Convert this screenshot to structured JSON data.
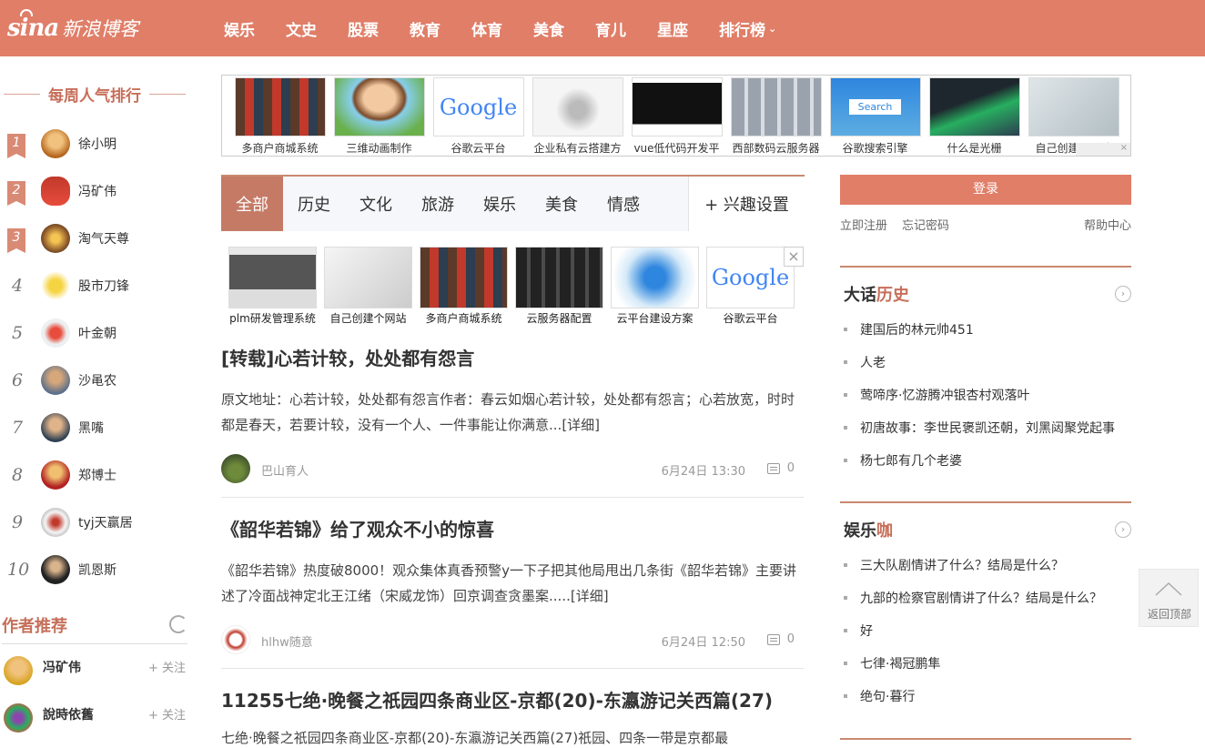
{
  "brand": {
    "logo": "sina",
    "name": "新浪博客",
    "nav_color": "#e07e68",
    "accent": "#c66f5a"
  },
  "nav": {
    "items": [
      "娱乐",
      "文史",
      "股票",
      "教育",
      "体育",
      "美食",
      "育儿",
      "星座"
    ],
    "ranking": "排行榜"
  },
  "weekly_rank": {
    "title": "每周人气排行",
    "entries": [
      {
        "rank": "1",
        "name": "徐小明"
      },
      {
        "rank": "2",
        "name": "冯矿伟"
      },
      {
        "rank": "3",
        "name": "淘气天尊"
      },
      {
        "rank": "4",
        "name": "股市刀锋"
      },
      {
        "rank": "5",
        "name": "叶金朝"
      },
      {
        "rank": "6",
        "name": "沙黾农"
      },
      {
        "rank": "7",
        "name": "黑嘴"
      },
      {
        "rank": "8",
        "name": "郑博士"
      },
      {
        "rank": "9",
        "name": "tyj天赢居"
      },
      {
        "rank": "10",
        "name": "凯恩斯"
      }
    ]
  },
  "author_rec": {
    "title": "作者推荐",
    "follow": "+ 关注",
    "authors": [
      {
        "name": "冯矿伟"
      },
      {
        "name": "說時依舊"
      }
    ]
  },
  "top_ads": [
    "多商户商城系统",
    "三维动画制作",
    "谷歌云平台",
    "企业私有云搭建方",
    "vue低代码开发平",
    "西部数码云服务器",
    "谷歌搜索引擎",
    "什么是光栅",
    "自己创建个网站"
  ],
  "ad_search_label": "Search",
  "ad_google_label": "Google",
  "tabs": {
    "items": [
      "全部",
      "历史",
      "文化",
      "旅游",
      "娱乐",
      "美食",
      "情感"
    ],
    "active": "全部",
    "setting": "+ 兴趣设置"
  },
  "inner_ads": [
    "plm研发管理系统",
    "自己创建个网站",
    "多商户商城系统",
    "云服务器配置",
    "云平台建设方案",
    "谷歌云平台"
  ],
  "inner_ad_close": "×",
  "articles": [
    {
      "title": "[转载]心若计较，处处都有怨言",
      "excerpt": "原文地址：心若计较，处处都有怨言作者：春云如烟心若计较，处处都有怨言；心若放宽，时时都是春天，若要计较，没有一个人、一件事能让你满意...",
      "more": "[详细]",
      "author": "巴山育人",
      "time": "6月24日 13:30",
      "comments": "0"
    },
    {
      "title": "《韶华若锦》给了观众不小的惊喜",
      "excerpt": "《韶华若锦》热度破8000！观众集体真香预警y一下子把其他局甩出几条街《韶华若锦》主要讲述了冷面战神定北王江绪（宋威龙饰）回京调查贪墨案.....",
      "more": "[详细]",
      "author": "hlhw随意",
      "time": "6月24日 12:50",
      "comments": "0"
    },
    {
      "title": "11255七绝·晚餐之祇园四条商业区-京都(20)-东瀛游记关西篇(27)",
      "excerpt": "七绝·晚餐之祇园四条商业区-京都(20)-东瀛游记关西篇(27)祇园、四条一带是京都最"
    }
  ],
  "login": {
    "button": "登录",
    "register": "立即注册",
    "forgot": "忘记密码",
    "help": "帮助中心"
  },
  "history_box": {
    "title_a": "大话",
    "title_b": "历史",
    "items": [
      "建国后的林元帅451",
      "人老",
      "莺啼序·忆游腾冲银杏村观落叶",
      "初唐故事：李世民褒凯还朝，刘黑闼聚党起事",
      "杨七郎有几个老婆"
    ]
  },
  "ent_box": {
    "title_a": "娱乐",
    "title_b": "咖",
    "items": [
      "三大队剧情讲了什么？结局是什么？",
      "九部的检察官剧情讲了什么？结局是什么？",
      "好",
      "七律·褐冠鹏隼",
      "绝句·暮行"
    ]
  },
  "back_to_top": "返回顶部"
}
